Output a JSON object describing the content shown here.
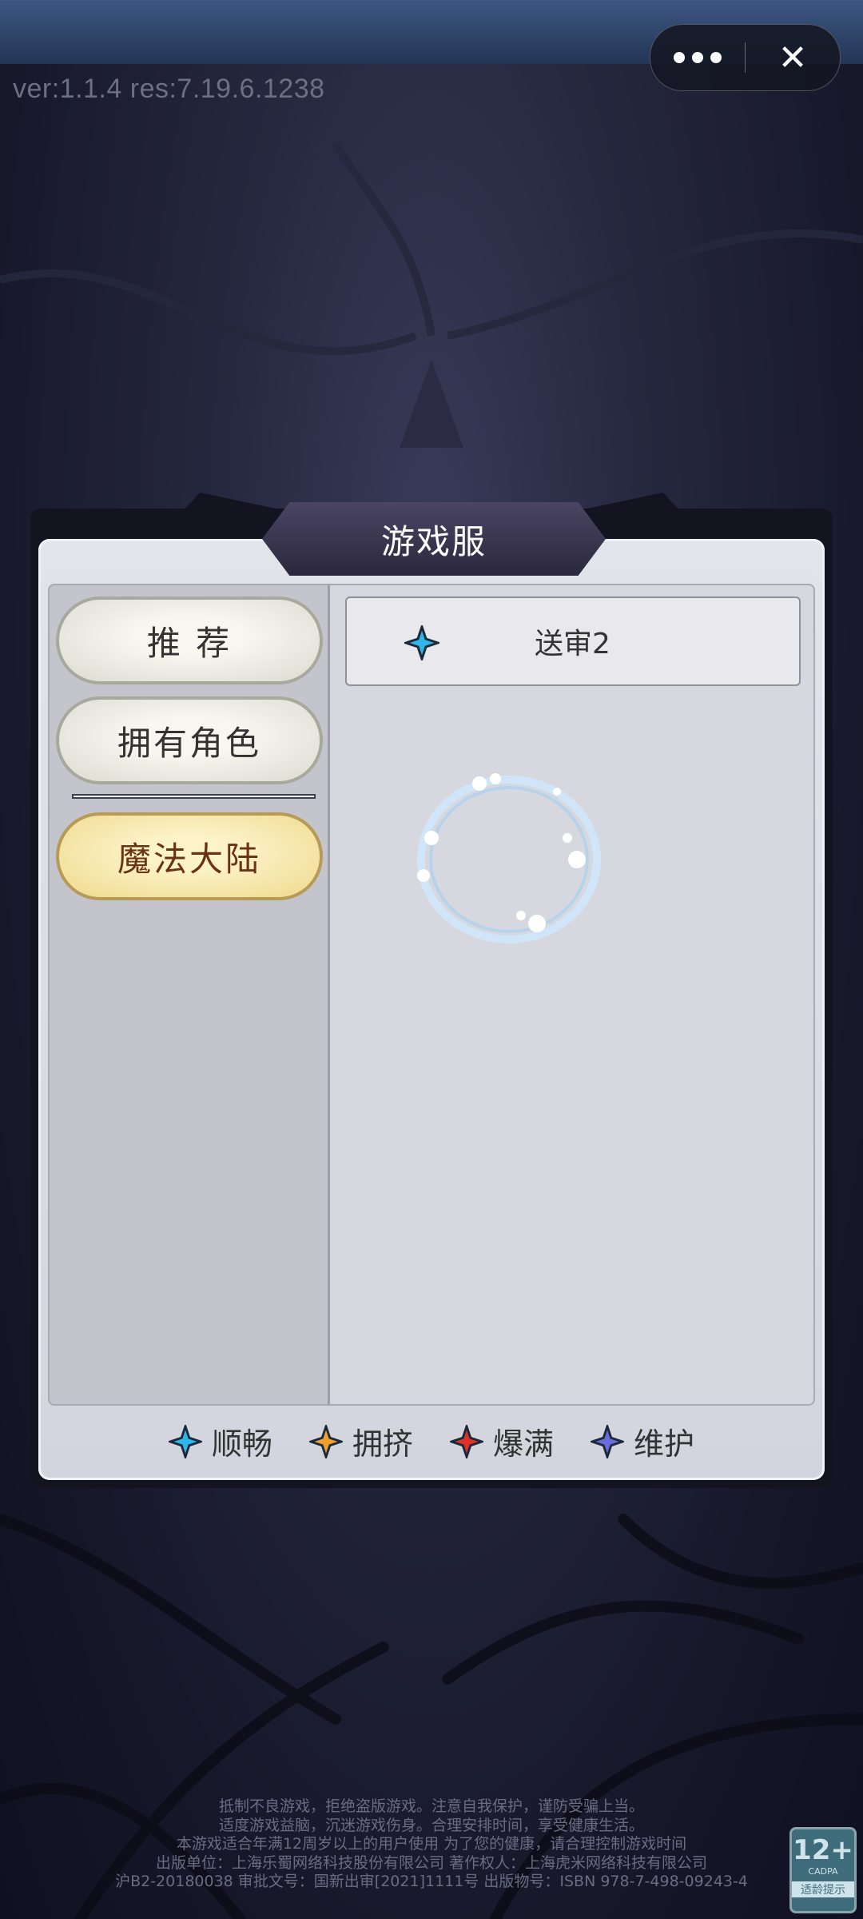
{
  "version_label": "ver:1.1.4  res:7.19.6.1238",
  "capsule": {
    "more_icon": "ellipsis-icon",
    "close_icon": "close-icon",
    "close_glyph": "✕"
  },
  "dialog": {
    "title": "游戏服",
    "tabs": [
      {
        "label": "推 荐",
        "active": false
      },
      {
        "label": "拥有角色",
        "active": false
      },
      {
        "label": "魔法大陆",
        "active": true
      }
    ],
    "servers": [
      {
        "name": "送审2",
        "status": "顺畅",
        "status_color": "#2fb6e8"
      }
    ],
    "legend": [
      {
        "label": "顺畅",
        "color": "#2fb6e8"
      },
      {
        "label": "拥挤",
        "color": "#f0a030"
      },
      {
        "label": "爆满",
        "color": "#e0302a"
      },
      {
        "label": "维护",
        "color": "#6a6ad8"
      }
    ]
  },
  "footer": {
    "lines": [
      "抵制不良游戏，拒绝盗版游戏。注意自我保护，谨防受骗上当。",
      "适度游戏益脑，沉迷游戏伤身。合理安排时间，享受健康生活。",
      "本游戏适合年满12周岁以上的用户使用 为了您的健康，请合理控制游戏时间",
      "出版单位：上海乐蜀网络科技股份有限公司  著作权人：上海虎米网络科技有限公司",
      "沪B2-20180038 审批文号：国新出审[2021]1111号 出版物号：ISBN 978-7-498-09243-4"
    ]
  },
  "rating": {
    "age": "12+",
    "org": "CADPA",
    "tip": "适龄提示"
  }
}
